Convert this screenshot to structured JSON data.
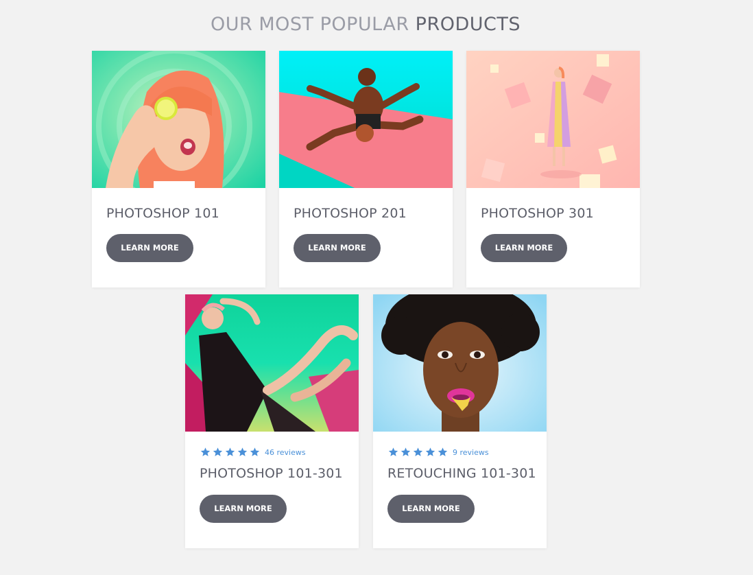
{
  "heading": {
    "light": "OUR MOST POPULAR ",
    "dark": "PRODUCTS"
  },
  "products": [
    {
      "title": "PHOTOSHOP 101",
      "button": "LEARN MORE"
    },
    {
      "title": "PHOTOSHOP 201",
      "button": "LEARN MORE"
    },
    {
      "title": "PHOTOSHOP 301",
      "button": "LEARN MORE"
    },
    {
      "title": "PHOTOSHOP 101-301",
      "button": "LEARN MORE",
      "stars": 5,
      "reviews": "46 reviews"
    },
    {
      "title": "RETOUCHING 101-301",
      "button": "LEARN MORE",
      "stars": 5,
      "reviews": "9 reviews"
    }
  ],
  "colors": {
    "background": "#f2f2f2",
    "button": "#5e606b",
    "star": "#4a90d8",
    "title": "#5c5e69"
  }
}
